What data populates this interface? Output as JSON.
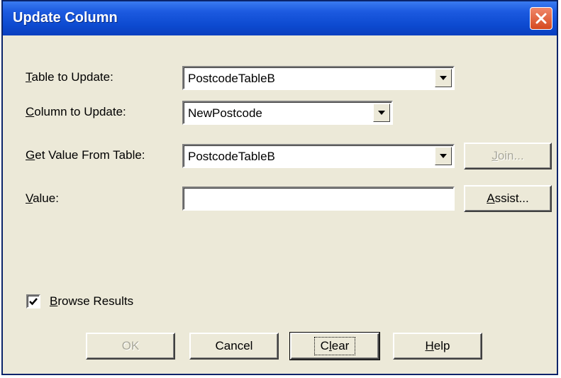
{
  "dialog": {
    "title": "Update Column"
  },
  "form": {
    "table_to_update": {
      "label_ul": "T",
      "label_rest": "able to Update:",
      "value": "PostcodeTableB"
    },
    "column_to_update": {
      "label_ul": "C",
      "label_rest": "olumn to Update:",
      "value": "NewPostcode"
    },
    "get_value_from_table": {
      "label_ul": "G",
      "label_rest": "et Value From Table:",
      "value": "PostcodeTableB"
    },
    "value": {
      "label_ul": "V",
      "label_rest": "alue:",
      "text": ""
    }
  },
  "buttons": {
    "join": {
      "label_ul": "J",
      "label_rest": "oin..."
    },
    "assist": {
      "label_ul": "A",
      "label_rest": "ssist..."
    },
    "ok": "OK",
    "cancel": "Cancel",
    "clear": {
      "label_pre": "C",
      "label_ul": "l",
      "label_rest": "ear"
    },
    "help": {
      "label_ul": "H",
      "label_rest": "elp"
    }
  },
  "browse_results": {
    "label_ul": "B",
    "label_rest": "rowse Results",
    "checked": true
  },
  "icons": {
    "close": "close-x-icon",
    "dropdown": "dropdown-arrow-icon",
    "check": "checkmark-icon"
  },
  "colors": {
    "titlebar": "#0d4ad0",
    "dialog_bg": "#ece9d8",
    "close_button": "#d5491f"
  }
}
